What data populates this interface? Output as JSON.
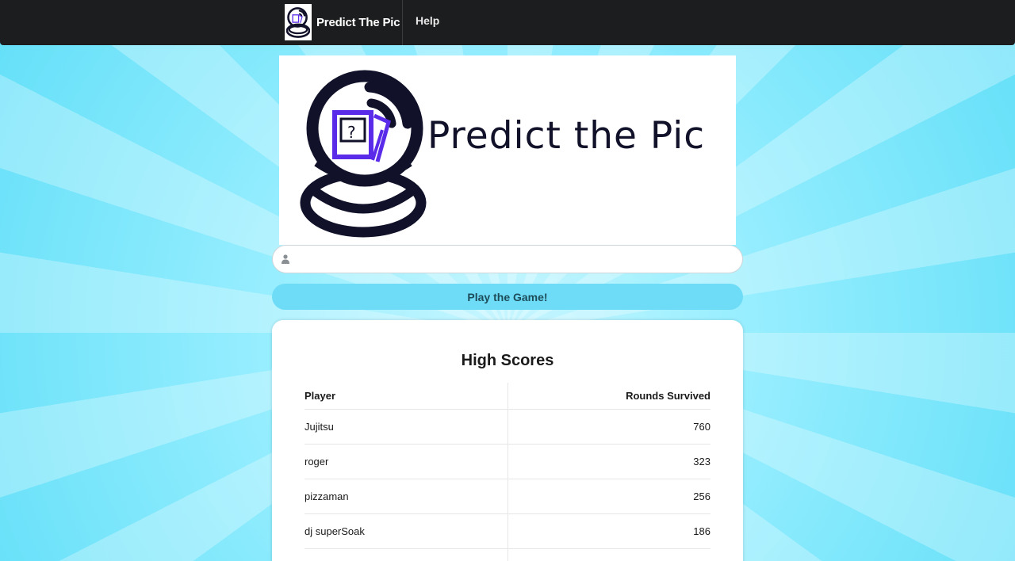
{
  "navbar": {
    "brand_title": "Predict The Pic",
    "help_label": "Help",
    "brand_logo_icon": "crystal-ball-cards-icon"
  },
  "hero": {
    "title": "Predict the Pic",
    "logo_icon": "crystal-ball-cards-icon"
  },
  "name_input": {
    "value": "",
    "placeholder": "",
    "icon": "user-icon"
  },
  "play_button": {
    "label": "Play the Game!"
  },
  "high_scores": {
    "title": "High Scores",
    "columns": [
      "Player",
      "Rounds Survived"
    ],
    "rows": [
      {
        "player": "Jujitsu",
        "rounds": "760"
      },
      {
        "player": "roger",
        "rounds": "323"
      },
      {
        "player": "pizzaman",
        "rounds": "256"
      },
      {
        "player": "dj superSoak",
        "rounds": "186"
      }
    ]
  },
  "colors": {
    "navbar": "#1c1d1f",
    "button": "#6fdcf7",
    "logo_navy": "#11112a",
    "logo_purple": "#5b2bea"
  }
}
